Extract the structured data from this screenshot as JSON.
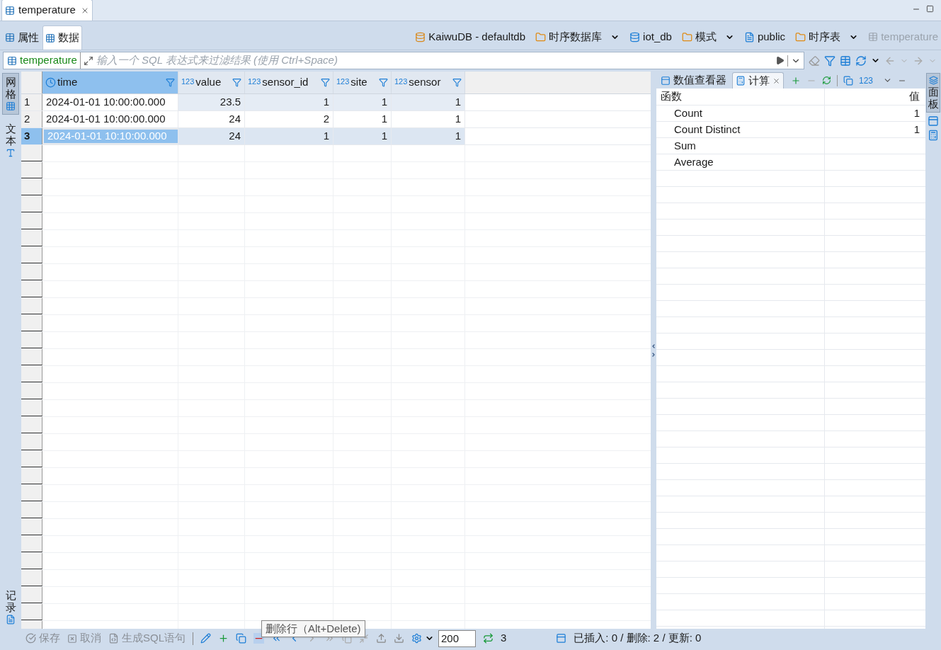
{
  "editor_tab": {
    "title": "temperature"
  },
  "sub_tabs": [
    {
      "label": "属性",
      "selected": false
    },
    {
      "label": "数据",
      "selected": true
    }
  ],
  "breadcrumb": [
    {
      "label": "KaiwuDB - defaultdb",
      "kind": "connection",
      "dropdown": false,
      "disabled": false
    },
    {
      "label": "时序数据库",
      "kind": "folder",
      "dropdown": true,
      "disabled": false
    },
    {
      "label": "iot_db",
      "kind": "database",
      "dropdown": false,
      "disabled": false
    },
    {
      "label": "模式",
      "kind": "folder",
      "dropdown": true,
      "disabled": false
    },
    {
      "label": "public",
      "kind": "schema",
      "dropdown": false,
      "disabled": false
    },
    {
      "label": "时序表",
      "kind": "folder",
      "dropdown": true,
      "disabled": false
    },
    {
      "label": "temperature",
      "kind": "table",
      "dropdown": false,
      "disabled": true
    }
  ],
  "filter": {
    "table": "temperature",
    "placeholder": "输入一个 SQL 表达式来过滤结果 (使用 Ctrl+Space)"
  },
  "view_tabs": [
    {
      "label": "网格",
      "kind": "grid",
      "selected": true
    },
    {
      "label": "文本",
      "kind": "text",
      "selected": false
    }
  ],
  "record_tab": {
    "label": "记录"
  },
  "grid": {
    "columns": [
      {
        "name": "time",
        "kind": "datetime",
        "selected": true
      },
      {
        "name": "value",
        "kind": "number",
        "type_label": "123",
        "selected": false
      },
      {
        "name": "sensor_id",
        "kind": "number",
        "type_label": "123",
        "selected": false
      },
      {
        "name": "site",
        "kind": "number",
        "type_label": "123",
        "selected": false
      },
      {
        "name": "sensor",
        "kind": "number",
        "type_label": "123",
        "selected": false
      }
    ],
    "rows": [
      {
        "number": "1",
        "selected": false,
        "cells": [
          {
            "text": "2024-01-01 10:00:00.000",
            "focused": false
          },
          {
            "text": "23.5",
            "focused": false
          },
          {
            "text": "1",
            "focused": false
          },
          {
            "text": "1",
            "focused": false
          },
          {
            "text": "1",
            "focused": false
          }
        ]
      },
      {
        "number": "2",
        "selected": false,
        "cells": [
          {
            "text": "2024-01-01 10:00:00.000",
            "focused": false
          },
          {
            "text": "24",
            "focused": false
          },
          {
            "text": "2",
            "focused": false
          },
          {
            "text": "1",
            "focused": false
          },
          {
            "text": "1",
            "focused": false
          }
        ]
      },
      {
        "number": "3",
        "selected": true,
        "cells": [
          {
            "text": "2024-01-01 10:10:00.000",
            "focused": true
          },
          {
            "text": "24",
            "focused": false
          },
          {
            "text": "1",
            "focused": false
          },
          {
            "text": "1",
            "focused": false
          },
          {
            "text": "1",
            "focused": false
          }
        ]
      }
    ]
  },
  "panel": {
    "tabs": [
      {
        "label": "数值查看器",
        "kind": "viewer",
        "selected": false,
        "closable": false
      },
      {
        "label": "计算",
        "kind": "calc",
        "selected": true,
        "closable": true
      }
    ],
    "toolbar_label": "123",
    "columns": [
      "函数",
      "值"
    ],
    "rows": [
      {
        "function": "Count",
        "value": "1"
      },
      {
        "function": "Count Distinct",
        "value": "1"
      },
      {
        "function": "Sum",
        "value": ""
      },
      {
        "function": "Average",
        "value": ""
      }
    ]
  },
  "side_tab": {
    "label": "面板"
  },
  "bottom": {
    "buttons": [
      {
        "label": "保存",
        "kind": "save",
        "disabled": true
      },
      {
        "label": "取消",
        "kind": "cancel",
        "disabled": true
      },
      {
        "label": "生成SQL语句",
        "kind": "sql",
        "disabled": true
      }
    ],
    "tooltip": "删除行（Alt+Delete)",
    "fetch_size": "200",
    "row_count": "3",
    "status": "已插入: 0 / 删除: 2 / 更新: 0"
  }
}
